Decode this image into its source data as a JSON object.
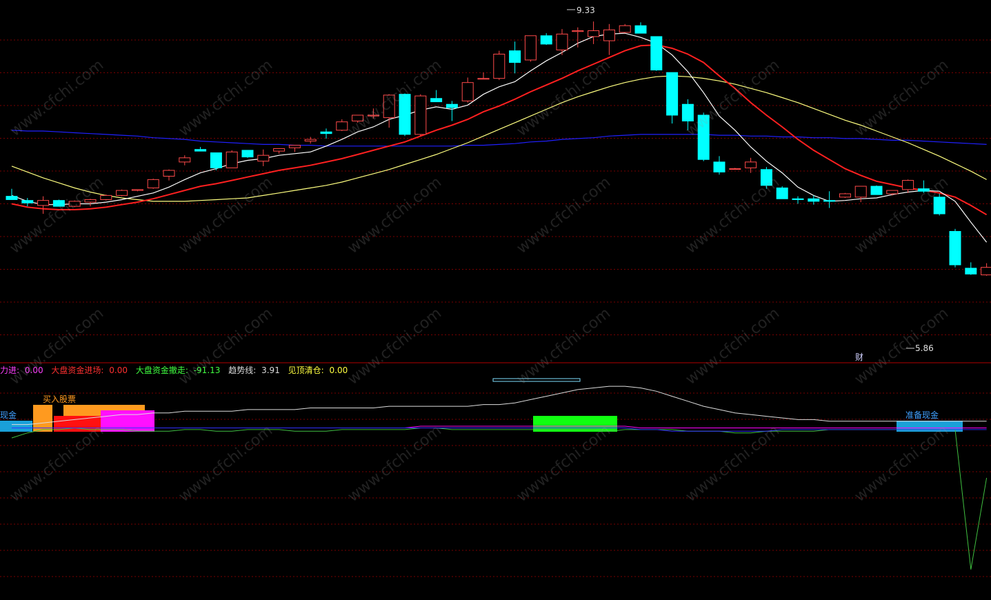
{
  "colors": {
    "up": "#ff4a4a",
    "down": "#00ffff",
    "ma5": "#ffffff",
    "ma10": "#ff2020",
    "ma30": "#ffff80",
    "ma60": "#2020ff",
    "grid": "#7a0000",
    "sig_trend": "#dddddd",
    "sig_green": "#40c040",
    "sig_magenta": "#ff00ff",
    "sig_red": "#ff3030",
    "sig_blue": "#3030ff"
  },
  "price_labels": {
    "high": "9.33",
    "low": "5.86",
    "marker": "财"
  },
  "indicator_legend": [
    {
      "label": "力进:",
      "value": "0.00",
      "color": "#ff40ff"
    },
    {
      "label": "大盘资金进场:",
      "value": "0.00",
      "color": "#ff3030"
    },
    {
      "label": "大盘资金撤走:",
      "value": "-91.13",
      "color": "#40ff40"
    },
    {
      "label": "趋势线:",
      "value": "3.91",
      "color": "#dddddd"
    },
    {
      "label": "见顶清仓:",
      "value": "0.00",
      "color": "#ffff40"
    }
  ],
  "signal_text": {
    "cash_left": "现金",
    "buy": "买入股票",
    "cash_right": "准备现金"
  },
  "watermark": "www.cfchi.com",
  "chart_data": [
    {
      "type": "candlestick",
      "ylim": [
        5.5,
        9.5
      ],
      "candles": [
        {
          "o": 7.26,
          "h": 7.35,
          "l": 7.22,
          "c": 7.22
        },
        {
          "o": 7.21,
          "h": 7.24,
          "l": 7.14,
          "c": 7.18
        },
        {
          "o": 7.15,
          "h": 7.26,
          "l": 7.05,
          "c": 7.21
        },
        {
          "o": 7.21,
          "h": 7.22,
          "l": 7.14,
          "c": 7.14
        },
        {
          "o": 7.14,
          "h": 7.21,
          "l": 7.13,
          "c": 7.2
        },
        {
          "o": 7.19,
          "h": 7.23,
          "l": 7.14,
          "c": 7.22
        },
        {
          "o": 7.22,
          "h": 7.28,
          "l": 7.21,
          "c": 7.27
        },
        {
          "o": 7.27,
          "h": 7.34,
          "l": 7.26,
          "c": 7.33
        },
        {
          "o": 7.33,
          "h": 7.34,
          "l": 7.32,
          "c": 7.34
        },
        {
          "o": 7.36,
          "h": 7.47,
          "l": 7.35,
          "c": 7.46
        },
        {
          "o": 7.5,
          "h": 7.58,
          "l": 7.45,
          "c": 7.57
        },
        {
          "o": 7.67,
          "h": 7.75,
          "l": 7.63,
          "c": 7.72
        },
        {
          "o": 7.82,
          "h": 7.85,
          "l": 7.8,
          "c": 7.8
        },
        {
          "o": 7.78,
          "h": 7.78,
          "l": 7.57,
          "c": 7.6
        },
        {
          "o": 7.6,
          "h": 7.81,
          "l": 7.6,
          "c": 7.79
        },
        {
          "o": 7.81,
          "h": 7.81,
          "l": 7.72,
          "c": 7.73
        },
        {
          "o": 7.68,
          "h": 7.82,
          "l": 7.62,
          "c": 7.75
        },
        {
          "o": 7.8,
          "h": 7.82,
          "l": 7.77,
          "c": 7.83
        },
        {
          "o": 7.84,
          "h": 7.86,
          "l": 7.79,
          "c": 7.87
        },
        {
          "o": 7.92,
          "h": 7.97,
          "l": 7.89,
          "c": 7.94
        },
        {
          "o": 8.03,
          "h": 8.07,
          "l": 7.95,
          "c": 8.01
        },
        {
          "o": 8.05,
          "h": 8.18,
          "l": 8.04,
          "c": 8.15
        },
        {
          "o": 8.16,
          "h": 8.22,
          "l": 8.14,
          "c": 8.23
        },
        {
          "o": 8.22,
          "h": 8.31,
          "l": 8.19,
          "c": 8.23
        },
        {
          "o": 8.2,
          "h": 8.48,
          "l": 8.08,
          "c": 8.47
        },
        {
          "o": 8.48,
          "h": 8.49,
          "l": 7.98,
          "c": 8.0
        },
        {
          "o": 8.0,
          "h": 8.48,
          "l": 7.98,
          "c": 8.46
        },
        {
          "o": 8.43,
          "h": 8.53,
          "l": 8.4,
          "c": 8.39
        },
        {
          "o": 8.36,
          "h": 8.4,
          "l": 8.16,
          "c": 8.32
        },
        {
          "o": 8.4,
          "h": 8.68,
          "l": 8.38,
          "c": 8.62
        },
        {
          "o": 8.66,
          "h": 8.74,
          "l": 8.67,
          "c": 8.67
        },
        {
          "o": 8.67,
          "h": 9.0,
          "l": 8.65,
          "c": 8.96
        },
        {
          "o": 9.0,
          "h": 9.11,
          "l": 8.73,
          "c": 8.86
        },
        {
          "o": 8.89,
          "h": 9.17,
          "l": 8.87,
          "c": 9.18
        },
        {
          "o": 9.18,
          "h": 9.21,
          "l": 9.07,
          "c": 9.08
        },
        {
          "o": 9.01,
          "h": 9.26,
          "l": 8.95,
          "c": 9.2
        },
        {
          "o": 9.23,
          "h": 9.28,
          "l": 9.04,
          "c": 9.24
        },
        {
          "o": 9.17,
          "h": 9.35,
          "l": 9.08,
          "c": 9.24
        },
        {
          "o": 9.12,
          "h": 9.32,
          "l": 8.95,
          "c": 9.25
        },
        {
          "o": 9.22,
          "h": 9.32,
          "l": 9.21,
          "c": 9.3
        },
        {
          "o": 9.3,
          "h": 9.34,
          "l": 9.23,
          "c": 9.21
        },
        {
          "o": 9.17,
          "h": 9.17,
          "l": 8.76,
          "c": 8.77
        },
        {
          "o": 8.74,
          "h": 8.74,
          "l": 8.13,
          "c": 8.23
        },
        {
          "o": 8.36,
          "h": 8.42,
          "l": 8.05,
          "c": 8.16
        },
        {
          "o": 8.23,
          "h": 8.26,
          "l": 7.68,
          "c": 7.7
        },
        {
          "o": 7.67,
          "h": 7.74,
          "l": 7.52,
          "c": 7.55
        },
        {
          "o": 7.59,
          "h": 7.6,
          "l": 7.59,
          "c": 7.59
        },
        {
          "o": 7.6,
          "h": 7.72,
          "l": 7.54,
          "c": 7.67
        },
        {
          "o": 7.58,
          "h": 7.61,
          "l": 7.35,
          "c": 7.39
        },
        {
          "o": 7.36,
          "h": 7.38,
          "l": 7.23,
          "c": 7.23
        },
        {
          "o": 7.23,
          "h": 7.26,
          "l": 7.17,
          "c": 7.22
        },
        {
          "o": 7.23,
          "h": 7.27,
          "l": 7.16,
          "c": 7.2
        },
        {
          "o": 7.21,
          "h": 7.32,
          "l": 7.12,
          "c": 7.2
        },
        {
          "o": 7.25,
          "h": 7.3,
          "l": 7.24,
          "c": 7.29
        },
        {
          "o": 7.25,
          "h": 7.38,
          "l": 7.19,
          "c": 7.38
        },
        {
          "o": 7.38,
          "h": 7.39,
          "l": 7.28,
          "c": 7.28
        },
        {
          "o": 7.29,
          "h": 7.33,
          "l": 7.27,
          "c": 7.33
        },
        {
          "o": 7.34,
          "h": 7.46,
          "l": 7.3,
          "c": 7.45
        },
        {
          "o": 7.35,
          "h": 7.45,
          "l": 7.3,
          "c": 7.32
        },
        {
          "o": 7.25,
          "h": 7.29,
          "l": 7.03,
          "c": 7.05
        },
        {
          "o": 6.84,
          "h": 6.87,
          "l": 6.41,
          "c": 6.44
        },
        {
          "o": 6.4,
          "h": 6.47,
          "l": 6.32,
          "c": 6.33
        },
        {
          "o": 6.32,
          "h": 6.46,
          "l": 6.31,
          "c": 6.41
        }
      ],
      "ma5": [
        7.27,
        7.2,
        7.16,
        7.16,
        7.17,
        7.17,
        7.19,
        7.22,
        7.26,
        7.3,
        7.37,
        7.46,
        7.54,
        7.59,
        7.65,
        7.69,
        7.71,
        7.75,
        7.77,
        7.79,
        7.86,
        7.94,
        8.03,
        8.09,
        8.18,
        8.23,
        8.29,
        8.33,
        8.3,
        8.35,
        8.48,
        8.57,
        8.63,
        8.76,
        8.88,
        8.98,
        9.09,
        9.17,
        9.2,
        9.21,
        9.16,
        9.09,
        8.95,
        8.75,
        8.5,
        8.22,
        8.05,
        7.85,
        7.68,
        7.54,
        7.37,
        7.27,
        7.2,
        7.21,
        7.23,
        7.24,
        7.28,
        7.31,
        7.33,
        7.32,
        7.2,
        6.95,
        6.71
      ],
      "ma10": [
        7.17,
        7.13,
        7.11,
        7.1,
        7.1,
        7.11,
        7.13,
        7.16,
        7.19,
        7.23,
        7.28,
        7.33,
        7.38,
        7.41,
        7.45,
        7.49,
        7.53,
        7.57,
        7.6,
        7.63,
        7.67,
        7.71,
        7.76,
        7.81,
        7.86,
        7.91,
        7.98,
        8.05,
        8.11,
        8.18,
        8.27,
        8.34,
        8.42,
        8.51,
        8.59,
        8.67,
        8.76,
        8.84,
        8.92,
        9.0,
        9.06,
        9.07,
        9.03,
        8.96,
        8.86,
        8.7,
        8.55,
        8.38,
        8.23,
        8.09,
        7.94,
        7.81,
        7.7,
        7.59,
        7.51,
        7.44,
        7.4,
        7.36,
        7.33,
        7.3,
        7.25,
        7.15,
        7.04
      ],
      "ma30": [
        7.62,
        7.55,
        7.48,
        7.42,
        7.36,
        7.31,
        7.27,
        7.24,
        7.22,
        7.2,
        7.2,
        7.2,
        7.21,
        7.22,
        7.23,
        7.24,
        7.27,
        7.3,
        7.33,
        7.36,
        7.39,
        7.43,
        7.48,
        7.53,
        7.58,
        7.64,
        7.7,
        7.76,
        7.83,
        7.9,
        7.98,
        8.06,
        8.14,
        8.22,
        8.3,
        8.38,
        8.45,
        8.51,
        8.57,
        8.62,
        8.66,
        8.69,
        8.7,
        8.69,
        8.67,
        8.64,
        8.6,
        8.55,
        8.5,
        8.44,
        8.38,
        8.31,
        8.24,
        8.17,
        8.11,
        8.04,
        7.97,
        7.9,
        7.82,
        7.74,
        7.65,
        7.56,
        7.46
      ],
      "ma60": [
        8.05,
        8.04,
        8.04,
        8.03,
        8.02,
        8.01,
        8.0,
        7.99,
        7.98,
        7.96,
        7.95,
        7.94,
        7.92,
        7.91,
        7.9,
        7.89,
        7.88,
        7.88,
        7.87,
        7.87,
        7.86,
        7.86,
        7.86,
        7.86,
        7.86,
        7.86,
        7.86,
        7.86,
        7.86,
        7.87,
        7.87,
        7.88,
        7.89,
        7.91,
        7.92,
        7.94,
        7.95,
        7.96,
        7.98,
        7.99,
        8.0,
        8.0,
        8.0,
        8.0,
        8.0,
        7.99,
        7.99,
        7.98,
        7.98,
        7.97,
        7.97,
        7.96,
        7.96,
        7.95,
        7.95,
        7.94,
        7.93,
        7.93,
        7.92,
        7.91,
        7.9,
        7.89,
        7.88
      ]
    },
    {
      "type": "line",
      "ylim": [
        -100,
        30
      ],
      "series": [
        {
          "key": "trend",
          "values": [
            2,
            2,
            3,
            4,
            5,
            6,
            7,
            8,
            8,
            9,
            9,
            10,
            10,
            10,
            10,
            11,
            11,
            11,
            11,
            12,
            12,
            12,
            12,
            12,
            13,
            13,
            13,
            13,
            13,
            13,
            14,
            14,
            15,
            17,
            19,
            21,
            23,
            24,
            25,
            25,
            24,
            22,
            19,
            16,
            13,
            11,
            9,
            8,
            7,
            6,
            5,
            5,
            4,
            4,
            4,
            4,
            4,
            4,
            4,
            4,
            4,
            4,
            4
          ]
        },
        {
          "key": "green",
          "values": [
            -6,
            -3,
            -1,
            -1,
            0,
            -1,
            -1,
            -1,
            -2,
            -2,
            -2,
            -1,
            -1,
            -2,
            -2,
            -1,
            -1,
            -1,
            -2,
            -2,
            -2,
            -1,
            -1,
            -1,
            -1,
            -1,
            0,
            0,
            -1,
            -1,
            -1,
            -1,
            -1,
            -1,
            -1,
            -1,
            -1,
            -1,
            -2,
            -1,
            -1,
            -1,
            -1,
            -2,
            -2,
            -2,
            -3,
            -3,
            -2,
            -2,
            -2,
            -2,
            -1,
            -1,
            -1,
            -1,
            -1,
            -1,
            -1,
            -1,
            -1,
            -85,
            -30
          ]
        },
        {
          "key": "magenta",
          "values": [
            0,
            0,
            0,
            0,
            0,
            0,
            0,
            0,
            0,
            0,
            0,
            0,
            0,
            0,
            0,
            0,
            0,
            0,
            0,
            0,
            0,
            0,
            0,
            0,
            0,
            0,
            1,
            1,
            1,
            1,
            1,
            1,
            1,
            1,
            1,
            1,
            1,
            1,
            1,
            1,
            0,
            0,
            0,
            0,
            0,
            0,
            0,
            0,
            0,
            0,
            0,
            0,
            0,
            0,
            0,
            0,
            0,
            0,
            0,
            0,
            0,
            0,
            0
          ]
        },
        {
          "key": "blue",
          "values": [
            0,
            0,
            0,
            0,
            0,
            0,
            0,
            0,
            0,
            0,
            0,
            0,
            0,
            0,
            0,
            0,
            0,
            0,
            0,
            0,
            0,
            0,
            0,
            0,
            0,
            0,
            0,
            0,
            0,
            0,
            0,
            0,
            0,
            0,
            0,
            0,
            0,
            0,
            0,
            0,
            -1,
            -1,
            -2,
            -2,
            -2,
            -2,
            -2,
            -2,
            -2,
            -1,
            -1,
            -1,
            -1,
            -1,
            -1,
            -1,
            -1,
            -1,
            -1,
            -1,
            -1,
            -1,
            -1
          ]
        }
      ]
    }
  ]
}
